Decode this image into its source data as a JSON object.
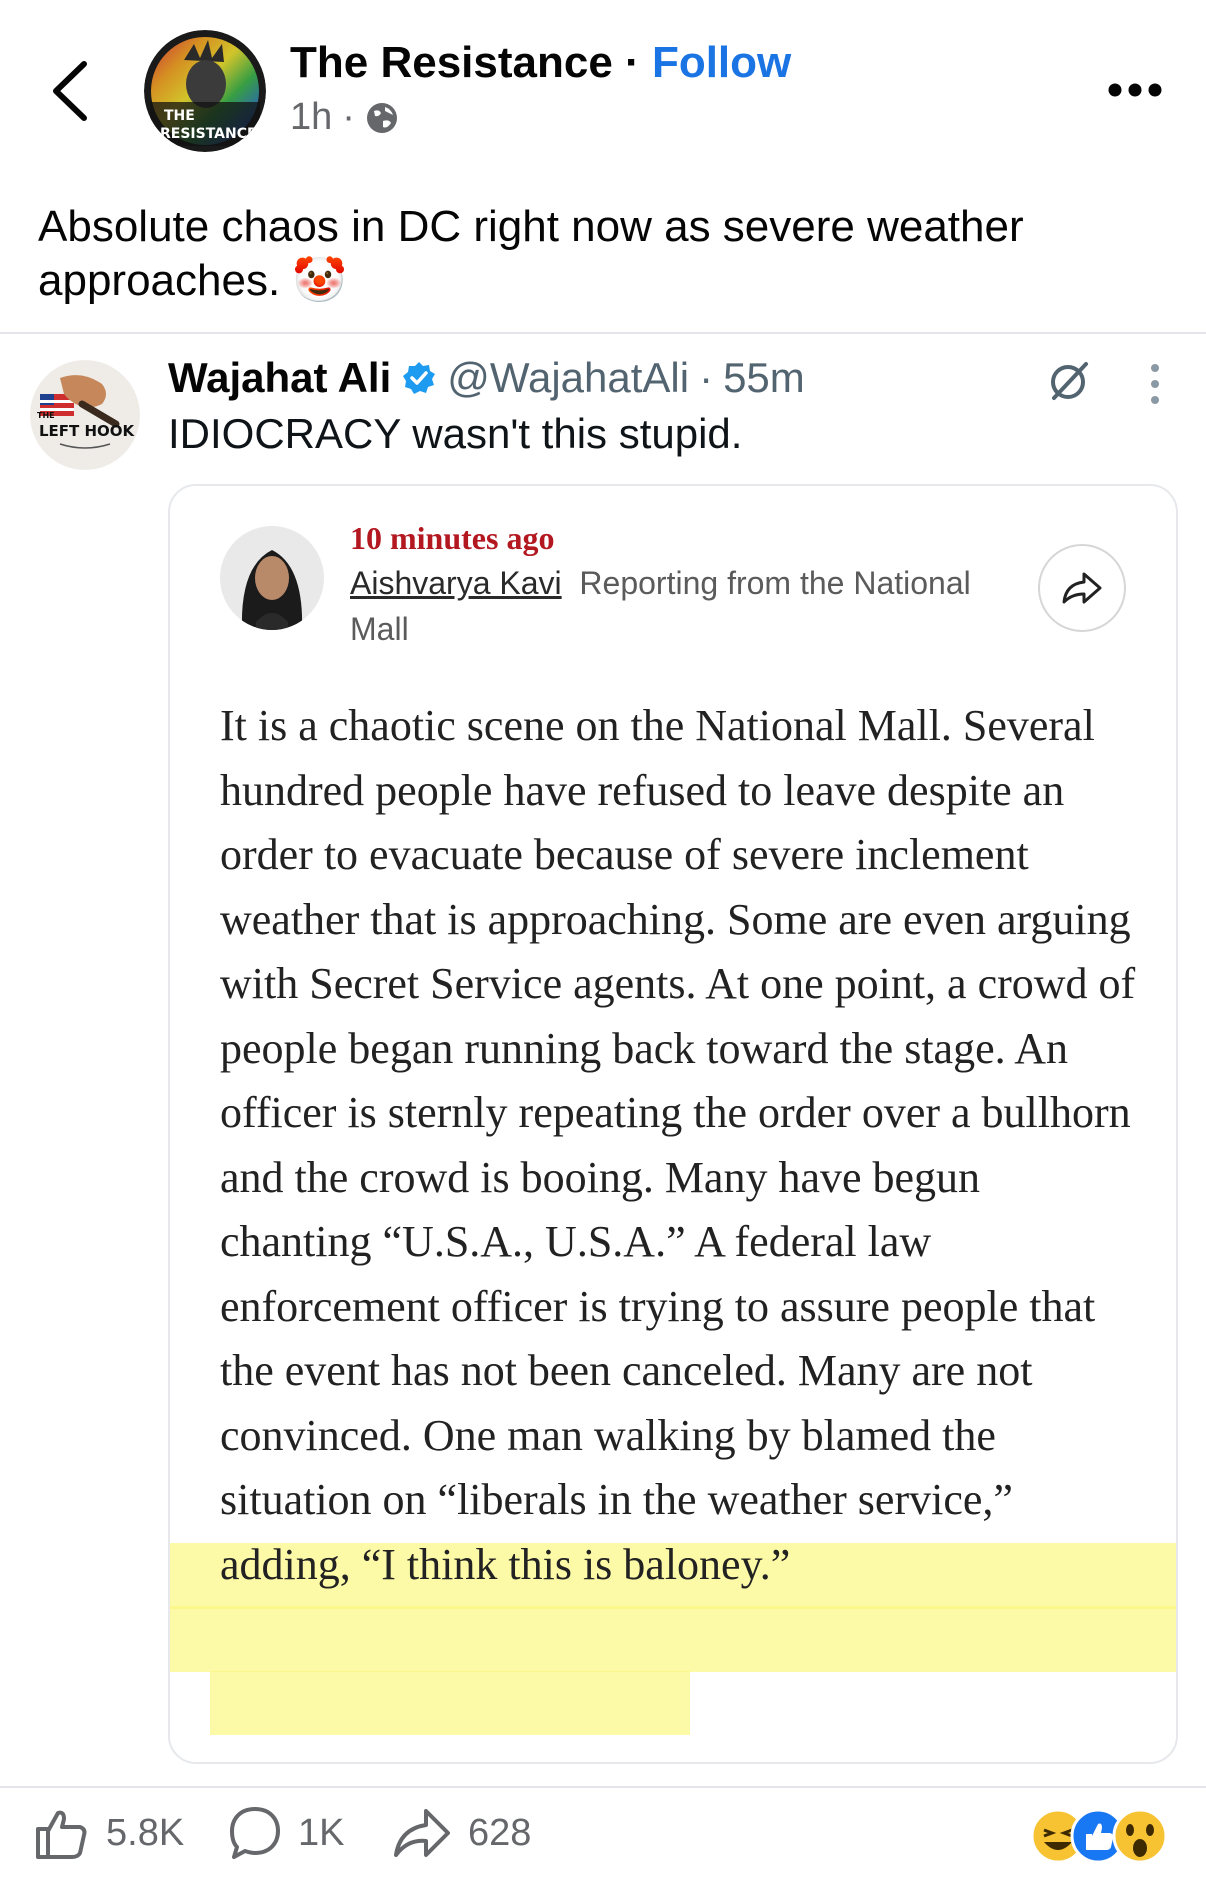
{
  "header": {
    "page_name": "The Resistance",
    "separator": "·",
    "follow_label": "Follow",
    "post_age": "1h",
    "meta_dot": "·",
    "audience_icon": "globe-icon",
    "avatar_text_line1": "THE",
    "avatar_text_line2": "RESISTANCE"
  },
  "post": {
    "text": "Absolute chaos in DC right now as severe weather approaches.",
    "emoji": "🤡"
  },
  "tweet": {
    "author_name": "Wajahat Ali",
    "verified_icon": "verified-badge-icon",
    "handle": "@WajahatAli",
    "dot": "·",
    "age": "55m",
    "text": "IDIOCRACY wasn't this stupid.",
    "avatar_text_small": "THE",
    "avatar_text": "LEFT HOOK"
  },
  "card": {
    "time_ago": "10 minutes ago",
    "reporter_name": "Aishvarya Kavi",
    "reporter_location": "Reporting from the National Mall",
    "article_text": "It is a chaotic scene on the National Mall. Several hundred people have refused to leave despite an order to evacuate because of severe inclement weather that is approaching. Some are even arguing with Secret Service agents. At one point, a crowd of people began running back toward the stage.  An officer is sternly repeating the order over a bullhorn and the crowd is booing. Many have begun chanting “U.S.A., U.S.A.” A federal law enforcement officer is trying to assure people that the event has not been canceled. Many are not convinced. One man walking by blamed the situation on “liberals in the weather service,” adding, “I think this is baloney.”",
    "highlight_color": "#faf678"
  },
  "actions": {
    "like_count": "5.8K",
    "comment_count": "1K",
    "share_count": "628"
  },
  "colors": {
    "follow_blue": "#1b74e4",
    "timestamp_red": "#b3171f",
    "verified_blue": "#1d9bf0"
  }
}
